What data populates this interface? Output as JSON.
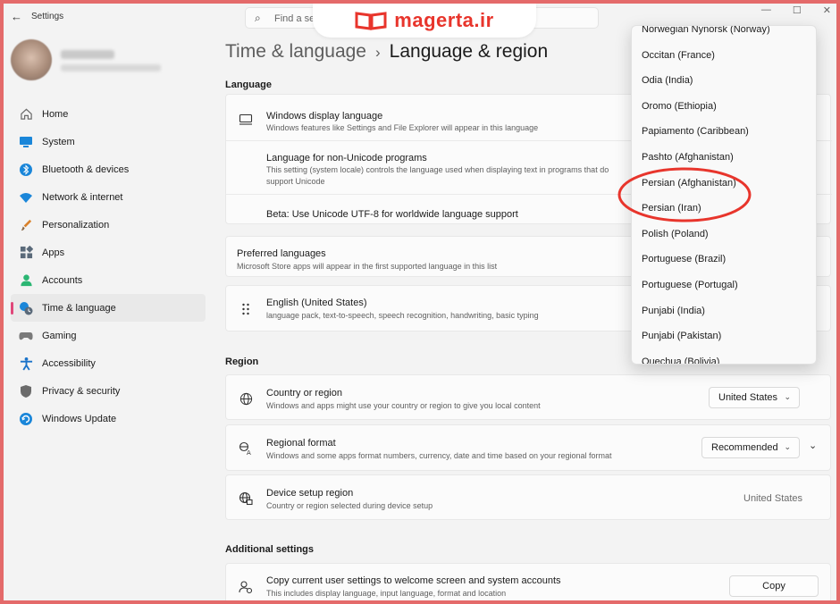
{
  "window": {
    "app_title": "Settings",
    "search_placeholder": "Find a se",
    "watermark_text": "magerta.ir"
  },
  "sidebar": {
    "items": [
      {
        "label": "Home",
        "icon": "home-icon",
        "color": "#6b6b6b"
      },
      {
        "label": "System",
        "icon": "system-icon",
        "color": "#1a86d9"
      },
      {
        "label": "Bluetooth & devices",
        "icon": "bluetooth-icon",
        "color": "#1a86d9"
      },
      {
        "label": "Network & internet",
        "icon": "wifi-icon",
        "color": "#1a86d9"
      },
      {
        "label": "Personalization",
        "icon": "brush-icon",
        "color": "#d9822b"
      },
      {
        "label": "Apps",
        "icon": "apps-icon",
        "color": "#5a6a7a"
      },
      {
        "label": "Accounts",
        "icon": "accounts-icon",
        "color": "#2bb673"
      },
      {
        "label": "Time & language",
        "icon": "clock-globe-icon",
        "color": "#1a86d9"
      },
      {
        "label": "Gaming",
        "icon": "gamepad-icon",
        "color": "#7a7a7a"
      },
      {
        "label": "Accessibility",
        "icon": "accessibility-icon",
        "color": "#1a73c9"
      },
      {
        "label": "Privacy & security",
        "icon": "shield-icon",
        "color": "#6b6b6b"
      },
      {
        "label": "Windows Update",
        "icon": "update-icon",
        "color": "#1a86d9"
      }
    ],
    "active_index": 7
  },
  "breadcrumb": {
    "parent": "Time & language",
    "separator": "›",
    "current": "Language & region"
  },
  "language": {
    "section_title": "Language",
    "display_title": "Windows display language",
    "display_sub": "Windows features like Settings and File Explorer will appear in this language",
    "nonunicode_title": "Language for non-Unicode programs",
    "nonunicode_sub1": "This setting (system locale) controls the language used when displaying text in programs that do",
    "nonunicode_sub2": "support Unicode",
    "beta_label": "Beta: Use Unicode UTF-8 for worldwide language support",
    "preferred_title": "Preferred languages",
    "preferred_sub": "Microsoft Store apps will appear in the first supported language in this list",
    "english_title": "English (United States)",
    "english_sub": "language pack, text-to-speech, speech recognition, handwriting, basic typing"
  },
  "region": {
    "section_title": "Region",
    "country_title": "Country or region",
    "country_sub": "Windows and apps might use your country or region to give you local content",
    "country_value": "United States",
    "format_title": "Regional format",
    "format_sub": "Windows and some apps format numbers, currency, date and time based on your regional format",
    "format_value": "Recommended",
    "device_title": "Device setup region",
    "device_sub": "Country or region selected during device setup",
    "device_value": "United States"
  },
  "additional": {
    "section_title": "Additional settings",
    "copy_title": "Copy current user settings to welcome screen and system accounts",
    "copy_sub": "This includes display language, input language, format and location",
    "copy_button": "Copy"
  },
  "dropdown": {
    "items": [
      "Norwegian Nynorsk (Norway)",
      "Occitan (France)",
      "Odia (India)",
      "Oromo (Ethiopia)",
      "Papiamento (Caribbean)",
      "Pashto (Afghanistan)",
      "Persian (Afghanistan)",
      "Persian (Iran)",
      "Polish (Poland)",
      "Portuguese (Brazil)",
      "Portuguese (Portugal)",
      "Punjabi (India)",
      "Punjabi (Pakistan)",
      "Quechua (Bolivia)"
    ]
  },
  "colors": {
    "accent": "#e0487a",
    "annotation": "#e8352c",
    "border": "#e46a6a"
  }
}
